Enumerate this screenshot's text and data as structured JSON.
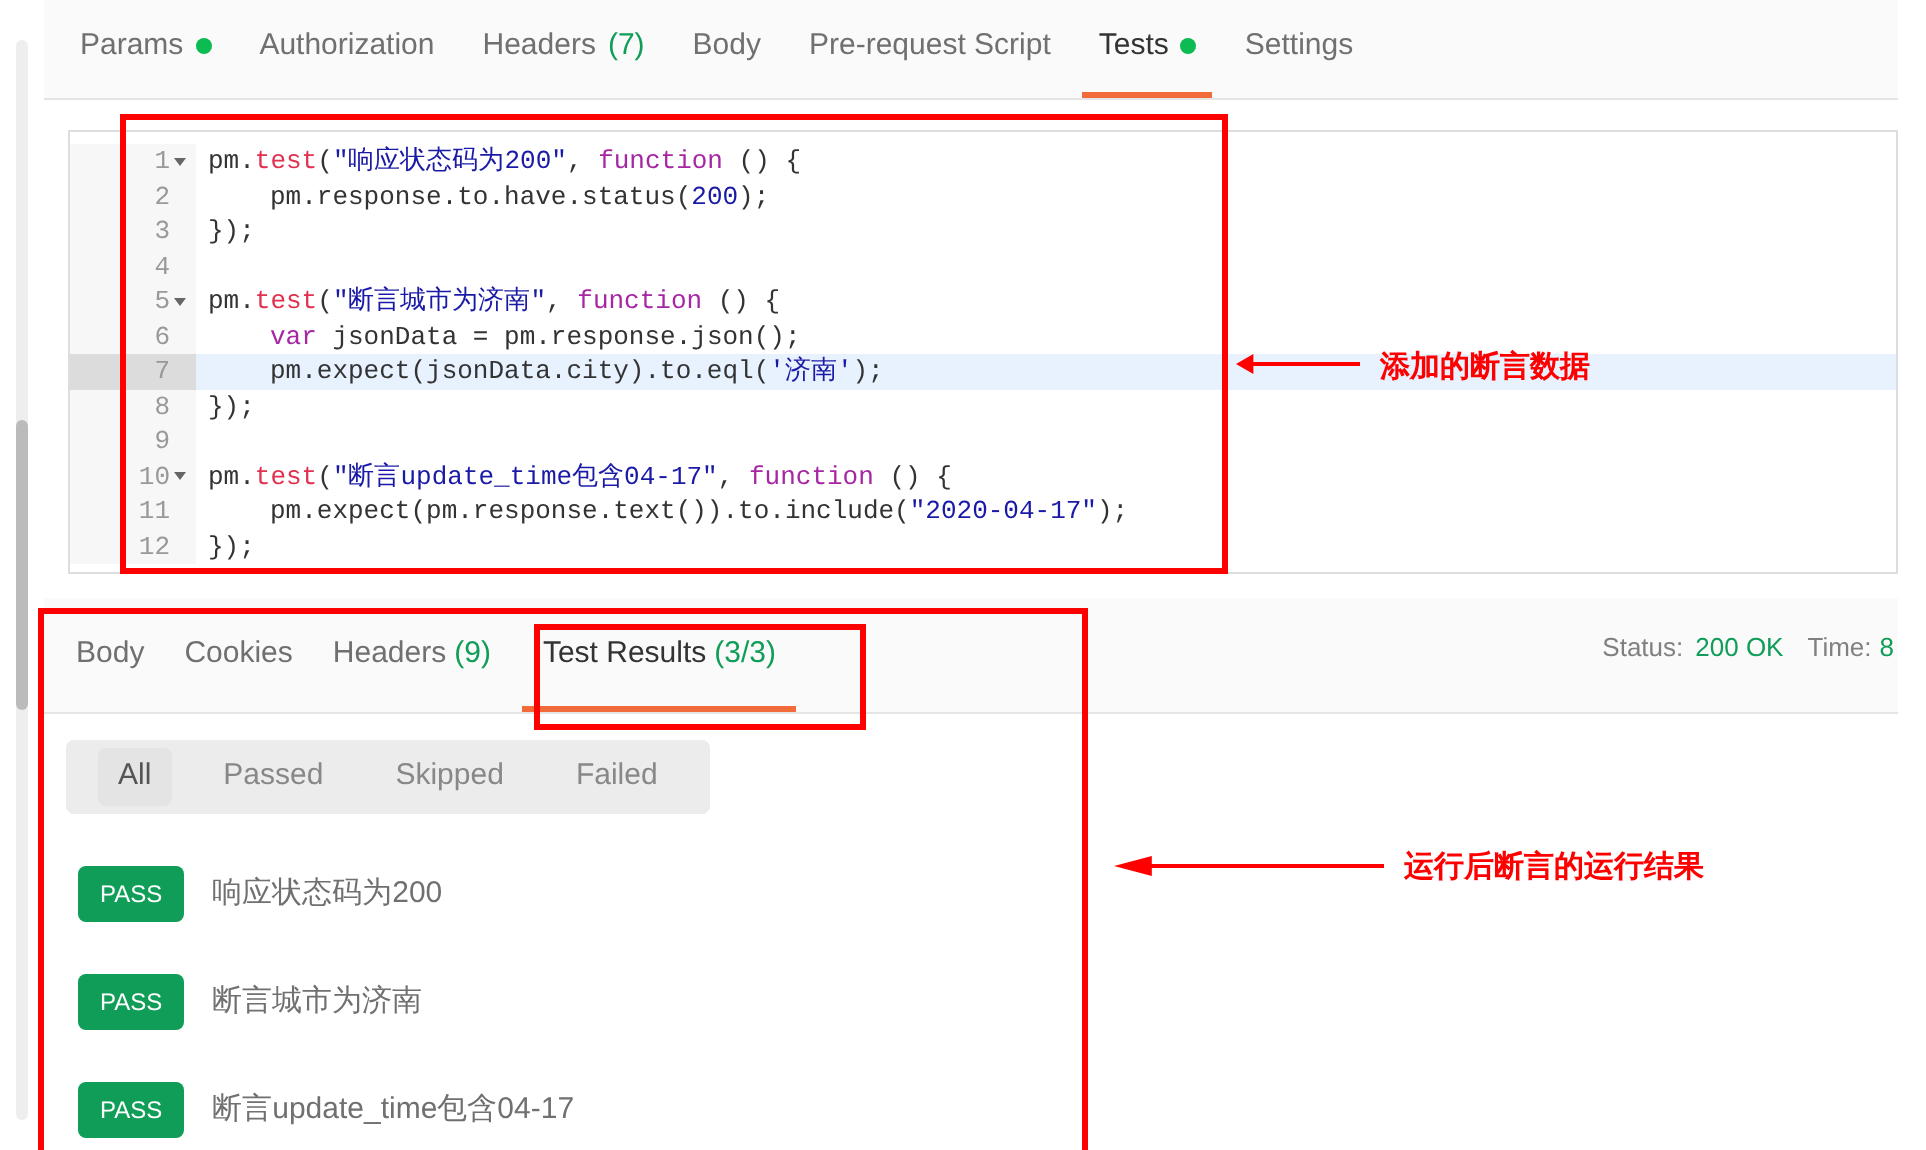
{
  "request_tabs": [
    {
      "label": "Params",
      "dot": true,
      "selected": false
    },
    {
      "label": "Authorization",
      "dot": false,
      "selected": false
    },
    {
      "label": "Headers",
      "count": "(7)",
      "dot": false,
      "selected": false
    },
    {
      "label": "Body",
      "dot": false,
      "selected": false
    },
    {
      "label": "Pre-request Script",
      "dot": false,
      "selected": false
    },
    {
      "label": "Tests",
      "dot": true,
      "selected": true
    },
    {
      "label": "Settings",
      "dot": false,
      "selected": false
    }
  ],
  "editor": {
    "lines": [
      {
        "number": "1",
        "foldable": true,
        "highlighted": false,
        "indented": false,
        "tokens": [
          {
            "text": "pm.",
            "kind": "plain"
          },
          {
            "text": "test",
            "kind": "method"
          },
          {
            "text": "(",
            "kind": "plain"
          },
          {
            "text": "\"响应状态码为200\"",
            "kind": "string"
          },
          {
            "text": ", ",
            "kind": "plain"
          },
          {
            "text": "function",
            "kind": "keyword"
          },
          {
            "text": " () {",
            "kind": "plain"
          }
        ]
      },
      {
        "number": "2",
        "foldable": false,
        "highlighted": false,
        "indented": true,
        "tokens": [
          {
            "text": "pm.response.to.have.status(",
            "kind": "plain"
          },
          {
            "text": "200",
            "kind": "number"
          },
          {
            "text": ");",
            "kind": "plain"
          }
        ]
      },
      {
        "number": "3",
        "foldable": false,
        "highlighted": false,
        "indented": false,
        "tokens": [
          {
            "text": "});",
            "kind": "plain"
          }
        ]
      },
      {
        "number": "4",
        "foldable": false,
        "highlighted": false,
        "indented": false
      },
      {
        "number": "5",
        "foldable": true,
        "highlighted": false,
        "indented": false,
        "tokens": [
          {
            "text": "pm.",
            "kind": "plain"
          },
          {
            "text": "test",
            "kind": "method"
          },
          {
            "text": "(",
            "kind": "plain"
          },
          {
            "text": "\"断言城市为济南\"",
            "kind": "string"
          },
          {
            "text": ", ",
            "kind": "plain"
          },
          {
            "text": "function",
            "kind": "keyword"
          },
          {
            "text": " () {",
            "kind": "plain"
          }
        ]
      },
      {
        "number": "6",
        "foldable": false,
        "highlighted": false,
        "indented": true,
        "tokens": [
          {
            "text": "var",
            "kind": "keyword"
          },
          {
            "text": " jsonData = pm.response.json();",
            "kind": "plain"
          }
        ]
      },
      {
        "number": "7",
        "foldable": false,
        "highlighted": true,
        "indented": true,
        "tokens": [
          {
            "text": "pm.expect(jsonData.city).to.eql(",
            "kind": "plain"
          },
          {
            "text": "'济南'",
            "kind": "string"
          },
          {
            "text": ");",
            "kind": "plain"
          }
        ]
      },
      {
        "number": "8",
        "foldable": false,
        "highlighted": false,
        "indented": false,
        "tokens": [
          {
            "text": "});",
            "kind": "plain"
          }
        ]
      },
      {
        "number": "9",
        "foldable": false,
        "highlighted": false,
        "indented": false
      },
      {
        "number": "10",
        "foldable": true,
        "highlighted": false,
        "indented": false,
        "tokens": [
          {
            "text": "pm.",
            "kind": "plain"
          },
          {
            "text": "test",
            "kind": "method"
          },
          {
            "text": "(",
            "kind": "plain"
          },
          {
            "text": "\"断言update_time包含04-17\"",
            "kind": "string"
          },
          {
            "text": ", ",
            "kind": "plain"
          },
          {
            "text": "function",
            "kind": "keyword"
          },
          {
            "text": " () {",
            "kind": "plain"
          }
        ]
      },
      {
        "number": "11",
        "foldable": false,
        "highlighted": false,
        "indented": true,
        "tokens": [
          {
            "text": "pm.expect(pm.response.text()).to.include(",
            "kind": "plain"
          },
          {
            "text": "\"2020-04-17\"",
            "kind": "string"
          },
          {
            "text": ");",
            "kind": "plain"
          }
        ]
      },
      {
        "number": "12",
        "foldable": false,
        "highlighted": false,
        "indented": false,
        "tokens": [
          {
            "text": "});",
            "kind": "plain"
          }
        ]
      }
    ]
  },
  "response_tabs": [
    {
      "label": "Body",
      "selected": false
    },
    {
      "label": "Cookies",
      "selected": false
    },
    {
      "label": "Headers",
      "count": "(9)",
      "selected": false
    },
    {
      "label": "Test Results",
      "count": "(3/3)",
      "selected": true
    }
  ],
  "status": {
    "label": "Status:",
    "value": "200 OK"
  },
  "time": {
    "label": "Time:",
    "value": "8"
  },
  "filters": [
    {
      "label": "All",
      "selected": true
    },
    {
      "label": "Passed",
      "selected": false
    },
    {
      "label": "Skipped",
      "selected": false
    },
    {
      "label": "Failed",
      "selected": false
    }
  ],
  "results": [
    {
      "status": "PASS",
      "name": "响应状态码为200"
    },
    {
      "status": "PASS",
      "name": "断言城市为济南"
    },
    {
      "status": "PASS",
      "name": "断言update_time包含04-17"
    }
  ],
  "annotations": {
    "editor_note": "添加的断言数据",
    "results_note": "运行后断言的运行结果"
  }
}
